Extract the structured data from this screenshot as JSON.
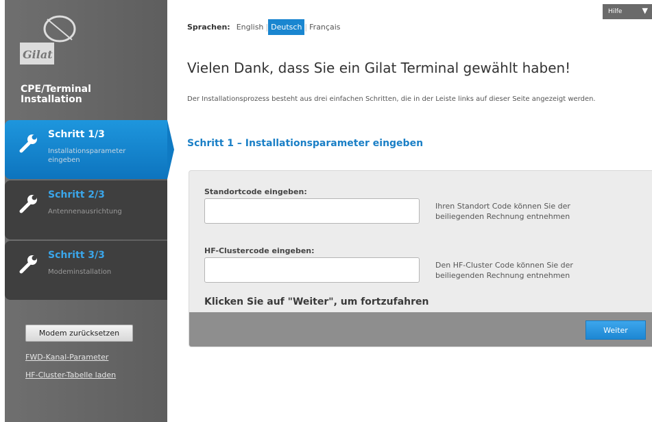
{
  "sidebar": {
    "logo_text": "Gilat",
    "title": "CPE/Terminal\nInstallation",
    "steps": [
      {
        "title": "Schritt 1/3",
        "desc": "Installationsparameter eingeben"
      },
      {
        "title": "Schritt 2/3",
        "desc": "Antennenausrichtung"
      },
      {
        "title": "Schritt 3/3",
        "desc": "Modeminstallation"
      }
    ],
    "reset_button": "Modem zurücksetzen",
    "links": [
      "FWD-Kanal-Parameter",
      "HF-Cluster-Tabelle laden"
    ]
  },
  "languages": {
    "label": "Sprachen:",
    "options": [
      "English",
      "Deutsch",
      "Français"
    ],
    "selected": "Deutsch"
  },
  "help": {
    "label": "Hilfe"
  },
  "main": {
    "heading": "Vielen Dank, dass Sie ein Gilat Terminal gewählt haben!",
    "intro": "Der Installationsprozess besteht aus drei einfachen Schritten, die in der Leiste links auf dieser Seite angezeigt werden.",
    "step_heading": "Schritt 1 – Installationsparameter eingeben",
    "fields": [
      {
        "label": "Standortcode eingeben:",
        "value": "",
        "help": "Ihren Standort Code können Sie der beiliegenden Rechnung entnehmen"
      },
      {
        "label": "HF-Clustercode eingeben:",
        "value": "",
        "help": "Den HF-Cluster Code können Sie der beiliegenden Rechnung entnehmen"
      }
    ],
    "cta": "Klicken Sie auf \"Weiter\", um fortzufahren",
    "next_button": "Weiter"
  },
  "colors": {
    "accent": "#1a86d0",
    "sidebar": "#666666",
    "step_active": "#1a86d0"
  }
}
